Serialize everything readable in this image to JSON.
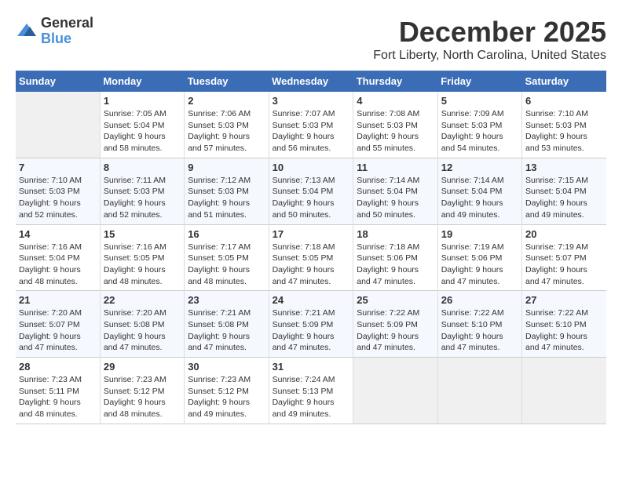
{
  "logo": {
    "general": "General",
    "blue": "Blue"
  },
  "title": "December 2025",
  "location": "Fort Liberty, North Carolina, United States",
  "weekdays": [
    "Sunday",
    "Monday",
    "Tuesday",
    "Wednesday",
    "Thursday",
    "Friday",
    "Saturday"
  ],
  "weeks": [
    [
      {
        "day": "",
        "empty": true
      },
      {
        "day": "1",
        "sunrise": "Sunrise: 7:05 AM",
        "sunset": "Sunset: 5:04 PM",
        "daylight": "Daylight: 9 hours and 58 minutes."
      },
      {
        "day": "2",
        "sunrise": "Sunrise: 7:06 AM",
        "sunset": "Sunset: 5:03 PM",
        "daylight": "Daylight: 9 hours and 57 minutes."
      },
      {
        "day": "3",
        "sunrise": "Sunrise: 7:07 AM",
        "sunset": "Sunset: 5:03 PM",
        "daylight": "Daylight: 9 hours and 56 minutes."
      },
      {
        "day": "4",
        "sunrise": "Sunrise: 7:08 AM",
        "sunset": "Sunset: 5:03 PM",
        "daylight": "Daylight: 9 hours and 55 minutes."
      },
      {
        "day": "5",
        "sunrise": "Sunrise: 7:09 AM",
        "sunset": "Sunset: 5:03 PM",
        "daylight": "Daylight: 9 hours and 54 minutes."
      },
      {
        "day": "6",
        "sunrise": "Sunrise: 7:10 AM",
        "sunset": "Sunset: 5:03 PM",
        "daylight": "Daylight: 9 hours and 53 minutes."
      }
    ],
    [
      {
        "day": "7",
        "sunrise": "Sunrise: 7:10 AM",
        "sunset": "Sunset: 5:03 PM",
        "daylight": "Daylight: 9 hours and 52 minutes."
      },
      {
        "day": "8",
        "sunrise": "Sunrise: 7:11 AM",
        "sunset": "Sunset: 5:03 PM",
        "daylight": "Daylight: 9 hours and 52 minutes."
      },
      {
        "day": "9",
        "sunrise": "Sunrise: 7:12 AM",
        "sunset": "Sunset: 5:03 PM",
        "daylight": "Daylight: 9 hours and 51 minutes."
      },
      {
        "day": "10",
        "sunrise": "Sunrise: 7:13 AM",
        "sunset": "Sunset: 5:04 PM",
        "daylight": "Daylight: 9 hours and 50 minutes."
      },
      {
        "day": "11",
        "sunrise": "Sunrise: 7:14 AM",
        "sunset": "Sunset: 5:04 PM",
        "daylight": "Daylight: 9 hours and 50 minutes."
      },
      {
        "day": "12",
        "sunrise": "Sunrise: 7:14 AM",
        "sunset": "Sunset: 5:04 PM",
        "daylight": "Daylight: 9 hours and 49 minutes."
      },
      {
        "day": "13",
        "sunrise": "Sunrise: 7:15 AM",
        "sunset": "Sunset: 5:04 PM",
        "daylight": "Daylight: 9 hours and 49 minutes."
      }
    ],
    [
      {
        "day": "14",
        "sunrise": "Sunrise: 7:16 AM",
        "sunset": "Sunset: 5:04 PM",
        "daylight": "Daylight: 9 hours and 48 minutes."
      },
      {
        "day": "15",
        "sunrise": "Sunrise: 7:16 AM",
        "sunset": "Sunset: 5:05 PM",
        "daylight": "Daylight: 9 hours and 48 minutes."
      },
      {
        "day": "16",
        "sunrise": "Sunrise: 7:17 AM",
        "sunset": "Sunset: 5:05 PM",
        "daylight": "Daylight: 9 hours and 48 minutes."
      },
      {
        "day": "17",
        "sunrise": "Sunrise: 7:18 AM",
        "sunset": "Sunset: 5:05 PM",
        "daylight": "Daylight: 9 hours and 47 minutes."
      },
      {
        "day": "18",
        "sunrise": "Sunrise: 7:18 AM",
        "sunset": "Sunset: 5:06 PM",
        "daylight": "Daylight: 9 hours and 47 minutes."
      },
      {
        "day": "19",
        "sunrise": "Sunrise: 7:19 AM",
        "sunset": "Sunset: 5:06 PM",
        "daylight": "Daylight: 9 hours and 47 minutes."
      },
      {
        "day": "20",
        "sunrise": "Sunrise: 7:19 AM",
        "sunset": "Sunset: 5:07 PM",
        "daylight": "Daylight: 9 hours and 47 minutes."
      }
    ],
    [
      {
        "day": "21",
        "sunrise": "Sunrise: 7:20 AM",
        "sunset": "Sunset: 5:07 PM",
        "daylight": "Daylight: 9 hours and 47 minutes."
      },
      {
        "day": "22",
        "sunrise": "Sunrise: 7:20 AM",
        "sunset": "Sunset: 5:08 PM",
        "daylight": "Daylight: 9 hours and 47 minutes."
      },
      {
        "day": "23",
        "sunrise": "Sunrise: 7:21 AM",
        "sunset": "Sunset: 5:08 PM",
        "daylight": "Daylight: 9 hours and 47 minutes."
      },
      {
        "day": "24",
        "sunrise": "Sunrise: 7:21 AM",
        "sunset": "Sunset: 5:09 PM",
        "daylight": "Daylight: 9 hours and 47 minutes."
      },
      {
        "day": "25",
        "sunrise": "Sunrise: 7:22 AM",
        "sunset": "Sunset: 5:09 PM",
        "daylight": "Daylight: 9 hours and 47 minutes."
      },
      {
        "day": "26",
        "sunrise": "Sunrise: 7:22 AM",
        "sunset": "Sunset: 5:10 PM",
        "daylight": "Daylight: 9 hours and 47 minutes."
      },
      {
        "day": "27",
        "sunrise": "Sunrise: 7:22 AM",
        "sunset": "Sunset: 5:10 PM",
        "daylight": "Daylight: 9 hours and 47 minutes."
      }
    ],
    [
      {
        "day": "28",
        "sunrise": "Sunrise: 7:23 AM",
        "sunset": "Sunset: 5:11 PM",
        "daylight": "Daylight: 9 hours and 48 minutes."
      },
      {
        "day": "29",
        "sunrise": "Sunrise: 7:23 AM",
        "sunset": "Sunset: 5:12 PM",
        "daylight": "Daylight: 9 hours and 48 minutes."
      },
      {
        "day": "30",
        "sunrise": "Sunrise: 7:23 AM",
        "sunset": "Sunset: 5:12 PM",
        "daylight": "Daylight: 9 hours and 49 minutes."
      },
      {
        "day": "31",
        "sunrise": "Sunrise: 7:24 AM",
        "sunset": "Sunset: 5:13 PM",
        "daylight": "Daylight: 9 hours and 49 minutes."
      },
      {
        "day": "",
        "empty": true
      },
      {
        "day": "",
        "empty": true
      },
      {
        "day": "",
        "empty": true
      }
    ]
  ]
}
